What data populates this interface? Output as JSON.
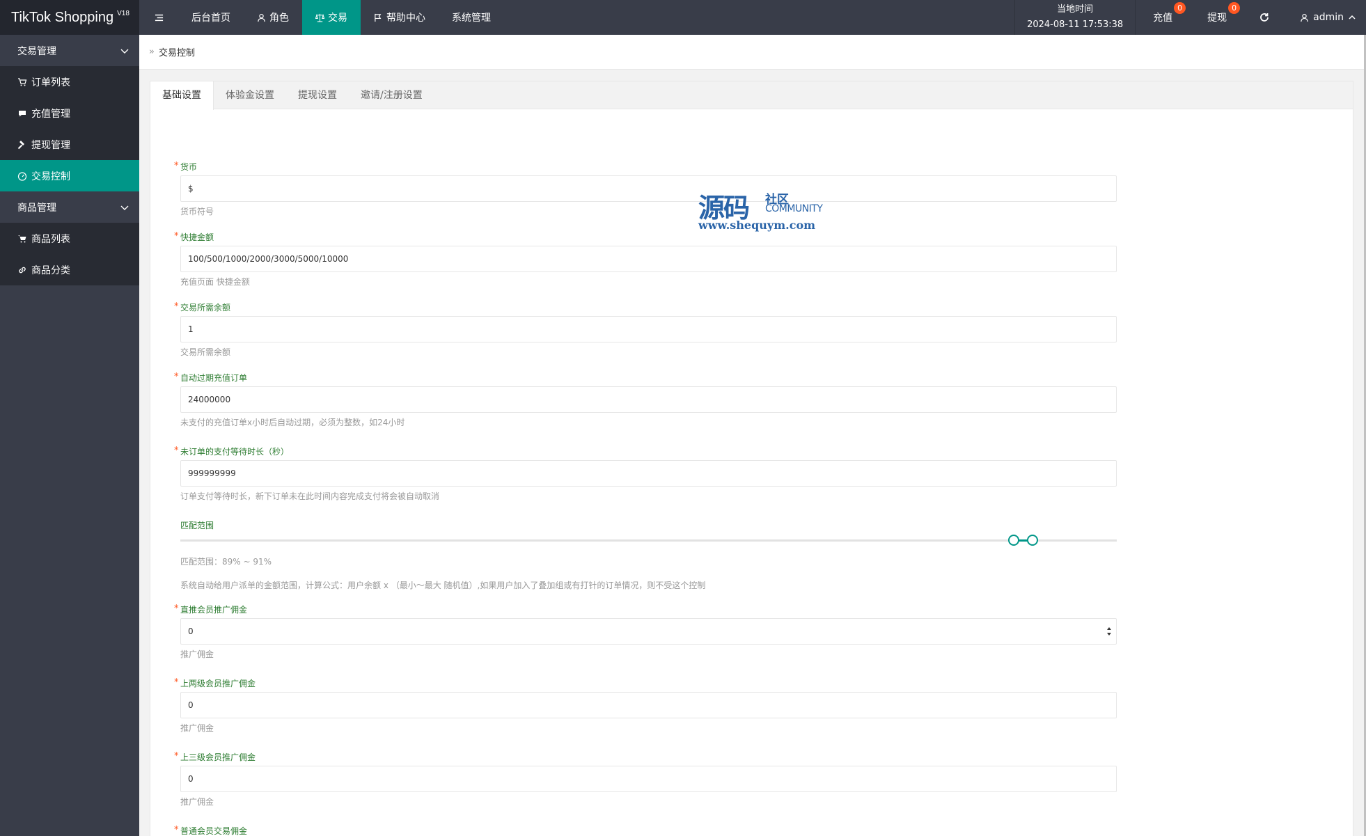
{
  "app": {
    "title": "TikTok Shopping",
    "version": "V18"
  },
  "nav": {
    "items": [
      {
        "label": "后台首页",
        "icon": ""
      },
      {
        "label": "角色",
        "icon": "user-icon"
      },
      {
        "label": "交易",
        "icon": "scale-icon"
      },
      {
        "label": "帮助中心",
        "icon": "flag-icon"
      },
      {
        "label": "系统管理",
        "icon": ""
      }
    ],
    "active_index": 2
  },
  "header": {
    "time_label": "当地时间",
    "time_value": "2024-08-11 17:53:38",
    "recharge_label": "充值",
    "recharge_count": "0",
    "withdraw_label": "提现",
    "withdraw_count": "0",
    "user": "admin"
  },
  "sidebar": {
    "groups": [
      {
        "label": "交易管理",
        "items": [
          {
            "label": "订单列表",
            "icon": "cart-icon"
          },
          {
            "label": "充值管理",
            "icon": "comment-icon"
          },
          {
            "label": "提现管理",
            "icon": "hammer-icon"
          },
          {
            "label": "交易控制",
            "icon": "gauge-icon"
          }
        ]
      },
      {
        "label": "商品管理",
        "items": [
          {
            "label": "商品列表",
            "icon": "cart-icon"
          },
          {
            "label": "商品分类",
            "icon": "link-icon"
          }
        ]
      }
    ],
    "active_item": "交易控制"
  },
  "breadcrumb": {
    "current": "交易控制"
  },
  "tabs": [
    "基础设置",
    "体验金设置",
    "提现设置",
    "邀请/注册设置"
  ],
  "form": {
    "currency": {
      "label": "货币",
      "value": "$",
      "hint": "货币符号"
    },
    "quick_amount": {
      "label": "快捷金额",
      "value": "100/500/1000/2000/3000/5000/10000",
      "hint": "充值页面 快捷金额"
    },
    "required_balance": {
      "label": "交易所需余额",
      "value": "1",
      "hint": "交易所需余额"
    },
    "auto_expire": {
      "label": "自动过期充值订单",
      "value": "24000000",
      "hint": "未支付的充值订单x小时后自动过期，必须为整数，如24小时"
    },
    "pay_wait": {
      "label": "未订单的支付等待时长（秒）",
      "value": "999999999",
      "hint": "订单支付等待时长，新下订单未在此时间内容完成支付将会被自动取消"
    },
    "match_range": {
      "label": "匹配范围",
      "min": 89,
      "max": 91,
      "range_text": "匹配范围：89% ~ 91%",
      "hint": "系统自动给用户派单的金额范围，计算公式：用户余额 x （最小～最大 随机值）,如果用户加入了叠加组或有打针的订单情况，则不受这个控制"
    },
    "direct_commission": {
      "label": "直推会员推广佣金",
      "value": "0",
      "hint": "推广佣金"
    },
    "level2_commission": {
      "label": "上两级会员推广佣金",
      "value": "0",
      "hint": "推广佣金"
    },
    "level3_commission": {
      "label": "上三级会员推广佣金",
      "value": "0",
      "hint": "推广佣金"
    },
    "normal_commission": {
      "label": "普通会员交易佣金"
    }
  },
  "watermark": {
    "cn": "源码",
    "cn2": "社区",
    "en": "COMMUNITY",
    "url": "www.shequym.com"
  },
  "colors": {
    "primary": "#009688",
    "header": "#393d49",
    "badge": "#ff5722"
  }
}
